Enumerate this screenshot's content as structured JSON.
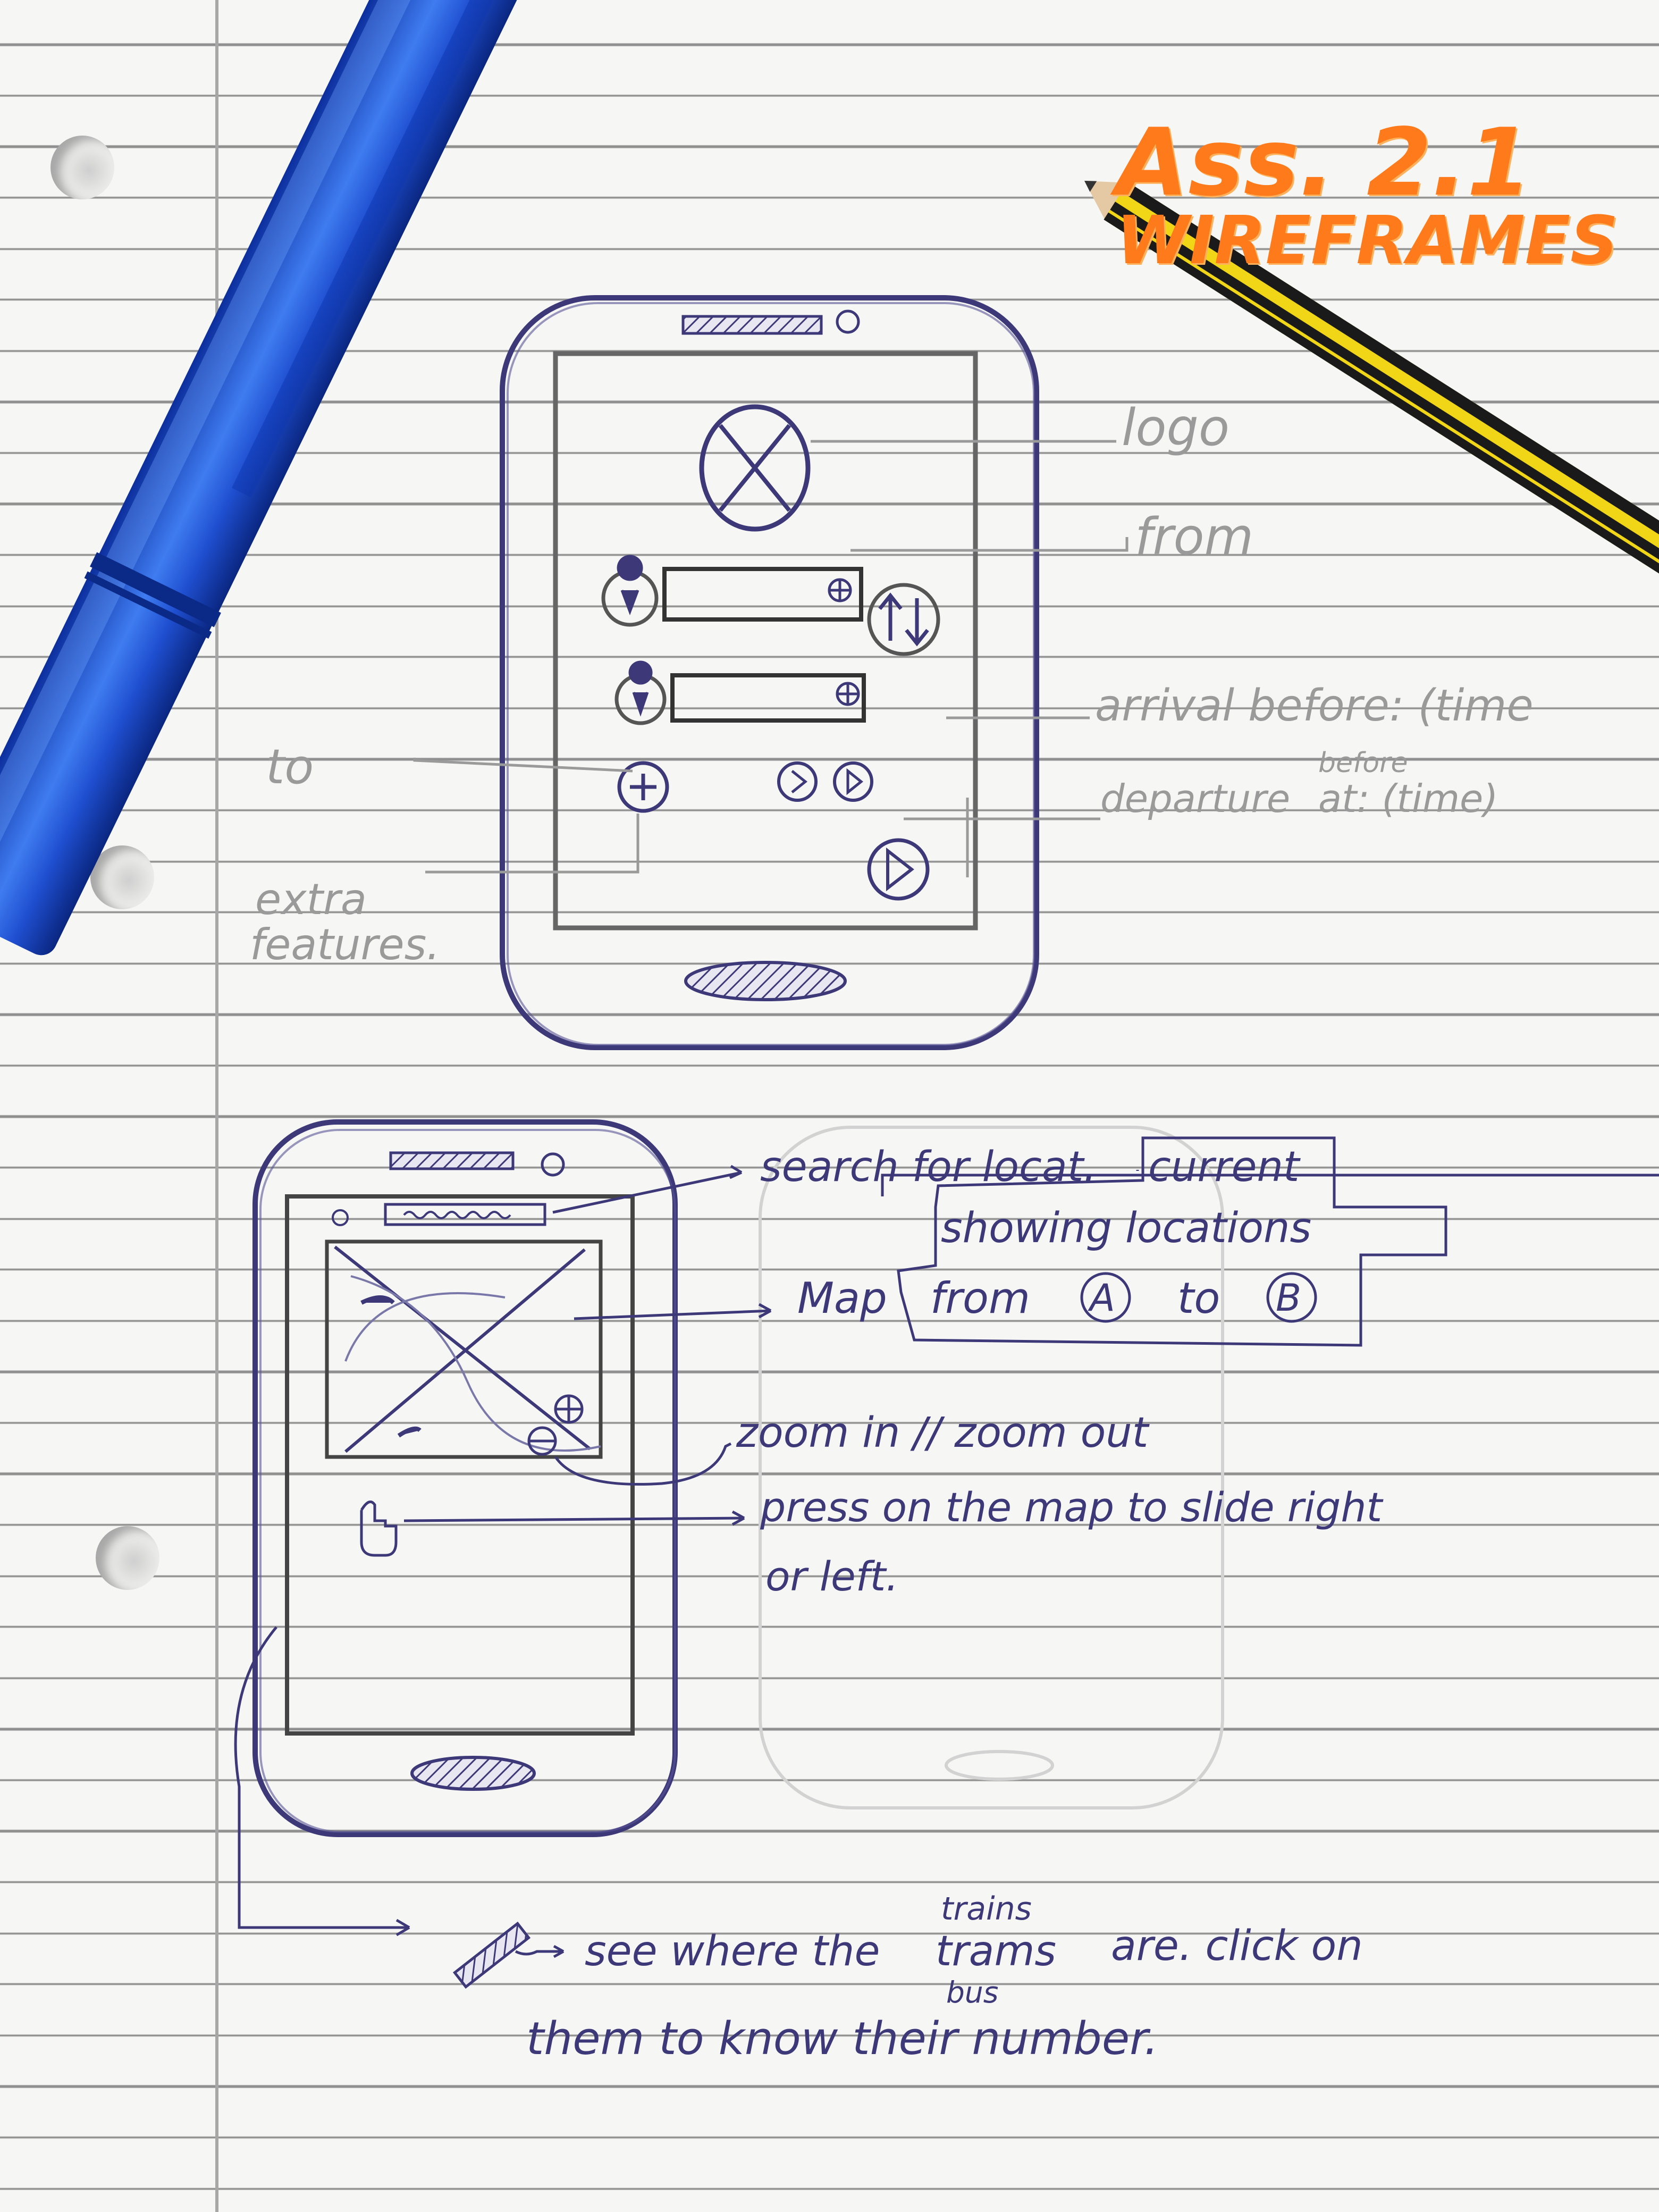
{
  "title": {
    "line1": "Ass. 2.1",
    "line2": "WIREFRAMES"
  },
  "wireframe1": {
    "annotations": {
      "logo": "logo",
      "from": "from",
      "to": "to",
      "arrival": "arrival before: (time",
      "departure": "departure",
      "departure_before": "before",
      "departure_rest": "at: (time)",
      "extra_line1": "extra",
      "extra_line2": "features."
    }
  },
  "wireframe2": {
    "annotations": {
      "search": "search for locat.",
      "current": "current",
      "showing": "showing locations",
      "map": "Map",
      "from": "from",
      "circle_a": "A",
      "to": "to",
      "circle_b": "B",
      "zoom": "zoom in // zoom out",
      "press_line1": "press on the map to slide right",
      "press_line2": "or left.",
      "trains_above": "trains",
      "see_where": "see where the",
      "trams": "trams",
      "bus_below": "bus",
      "are_click": "are. click on",
      "them": "them to know their number."
    }
  },
  "colors": {
    "blue_ink": "#3d3878",
    "pencil": "#9a9a9a",
    "orange_marker": "#ff7a1a",
    "paper": "#f6f6f4",
    "pen_blue": "#1f4fd0"
  },
  "objects": {
    "pen": "blue-pen",
    "pencil": "yellow-black-pencil"
  }
}
